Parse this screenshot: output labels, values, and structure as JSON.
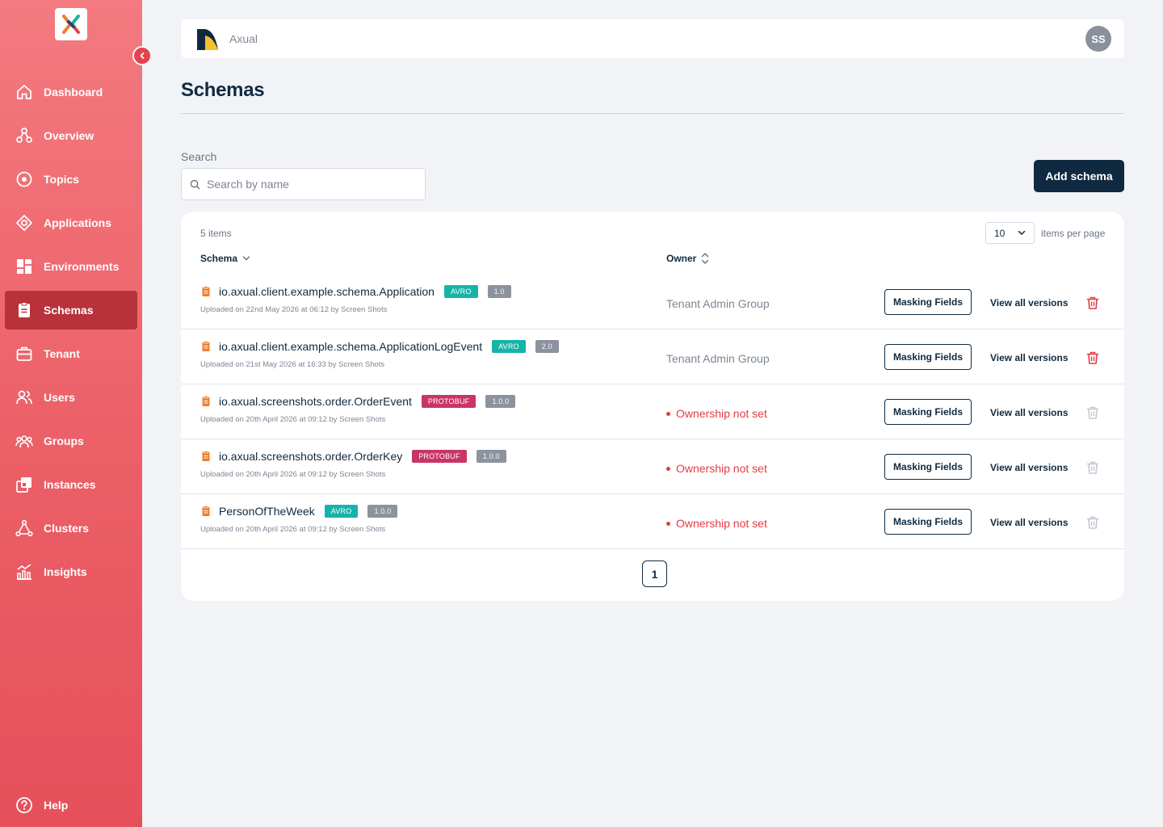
{
  "sidebar": {
    "items": [
      {
        "label": "Dashboard",
        "icon": "home-icon"
      },
      {
        "label": "Overview",
        "icon": "overview-icon"
      },
      {
        "label": "Topics",
        "icon": "topics-icon"
      },
      {
        "label": "Applications",
        "icon": "applications-icon"
      },
      {
        "label": "Environments",
        "icon": "environments-icon"
      },
      {
        "label": "Schemas",
        "icon": "schemas-icon"
      },
      {
        "label": "Tenant",
        "icon": "tenant-icon"
      },
      {
        "label": "Users",
        "icon": "users-icon"
      },
      {
        "label": "Groups",
        "icon": "groups-icon"
      },
      {
        "label": "Instances",
        "icon": "instances-icon"
      },
      {
        "label": "Clusters",
        "icon": "clusters-icon"
      },
      {
        "label": "Insights",
        "icon": "insights-icon"
      }
    ],
    "active": "Schemas",
    "help_label": "Help"
  },
  "topbar": {
    "tenant_name": "Axual",
    "avatar_initials": "SS"
  },
  "page": {
    "title": "Schemas"
  },
  "search": {
    "label": "Search",
    "placeholder": "Search by name",
    "value": ""
  },
  "add_button_label": "Add schema",
  "table": {
    "items_count": "5 items",
    "per_page_value": "10",
    "per_page_label": "items per page",
    "columns": {
      "schema": "Schema",
      "owner": "Owner"
    },
    "masking_label": "Masking Fields",
    "versions_label": "View all versions",
    "rows": [
      {
        "name": "io.axual.client.example.schema.Application",
        "type": "AVRO",
        "version": "1.0",
        "uploaded": "Uploaded on 22nd May 2026 at 06:12 by Screen Shots",
        "owner": "Tenant Admin Group",
        "owner_set": true
      },
      {
        "name": "io.axual.client.example.schema.ApplicationLogEvent",
        "type": "AVRO",
        "version": "2.0",
        "uploaded": "Uploaded on 21st May 2026 at 16:33 by Screen Shots",
        "owner": "Tenant Admin Group",
        "owner_set": true
      },
      {
        "name": "io.axual.screenshots.order.OrderEvent",
        "type": "PROTOBUF",
        "version": "1.0.0",
        "uploaded": "Uploaded on 20th April 2026 at 09:12 by Screen Shots",
        "owner": "Ownership not set",
        "owner_set": false
      },
      {
        "name": "io.axual.screenshots.order.OrderKey",
        "type": "PROTOBUF",
        "version": "1.0.0",
        "uploaded": "Uploaded on 20th April 2026 at 09:12 by Screen Shots",
        "owner": "Ownership not set",
        "owner_set": false
      },
      {
        "name": "PersonOfTheWeek",
        "type": "AVRO",
        "version": "1.0.0",
        "uploaded": "Uploaded on 20th April 2026 at 09:12 by Screen Shots",
        "owner": "Ownership not set",
        "owner_set": false
      }
    ]
  },
  "pagination": {
    "current_page": "1"
  },
  "colors": {
    "sidebar_top": "#f37a80",
    "sidebar_bottom": "#e5505b",
    "sidebar_active": "#b8323b",
    "primary_dark": "#0f2a40",
    "avro_badge": "#16b3a8",
    "protobuf_badge": "#c93565",
    "version_badge": "#8c929e",
    "danger": "#e23b45",
    "schema_icon": "#f07d2d"
  }
}
